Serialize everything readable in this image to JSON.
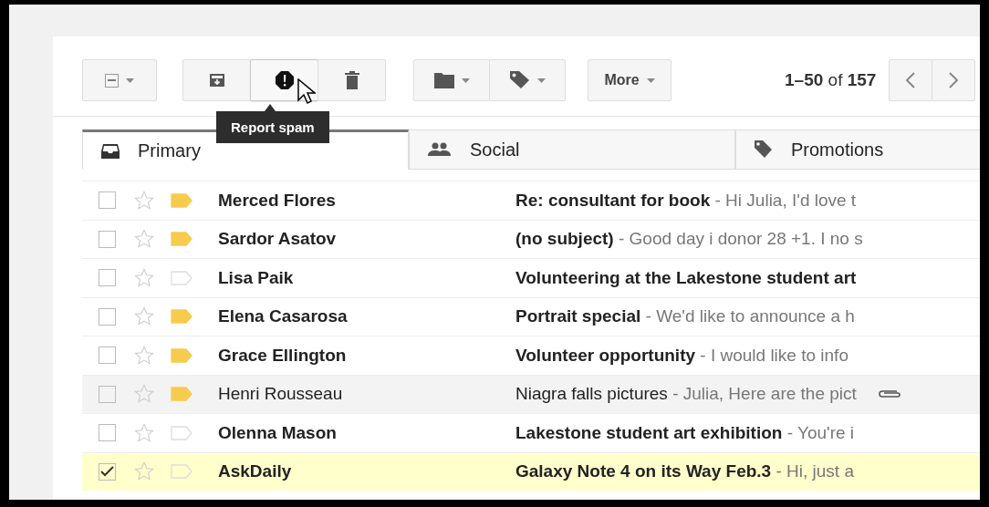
{
  "toolbar": {
    "select_all": {
      "indeterminate": true
    },
    "actions": [
      {
        "kind": "archive",
        "hovered": false
      },
      {
        "kind": "spam",
        "hovered": true
      },
      {
        "kind": "delete",
        "hovered": false
      }
    ],
    "organize": [
      {
        "kind": "folder"
      },
      {
        "kind": "tag"
      }
    ],
    "more": "More",
    "count": "**1–50** of **157**"
  },
  "tooltip": "Report spam",
  "tabs": [
    {
      "label": "Primary",
      "kind": "inbox",
      "selected": true
    },
    {
      "label": "Social",
      "kind": "people",
      "selected": false
    },
    {
      "label": "Promotions",
      "kind": "tag",
      "selected": false
    }
  ],
  "rows": [
    {
      "sender": "Merced Flores",
      "subject": "Re: consultant for book",
      "snippet": "- Hi Julia, I'd love t",
      "unread": true,
      "important": true,
      "checked": false,
      "starred": false,
      "attachment": false
    },
    {
      "sender": "Sardor Asatov",
      "subject": "(no subject)",
      "snippet": "- Good day i donor 28 +1. I no s",
      "unread": true,
      "important": true,
      "checked": false,
      "starred": false,
      "attachment": false
    },
    {
      "sender": "Lisa Paik",
      "subject": "Volunteering at the Lakestone student art",
      "unread": true,
      "important": false,
      "checked": false,
      "starred": false,
      "attachment": false
    },
    {
      "sender": "Elena Casarosa",
      "subject": "Portrait special",
      "snippet": "- We'd like to announce a h",
      "unread": true,
      "important": true,
      "checked": false,
      "starred": false,
      "attachment": false
    },
    {
      "sender": "Grace Ellington",
      "subject": "Volunteer opportunity",
      "snippet": "- I would like to info",
      "unread": true,
      "important": true,
      "checked": false,
      "starred": false,
      "attachment": false
    },
    {
      "sender": "Henri Rousseau",
      "subject": "Niagra falls pictures",
      "snippet": "- Julia, Here are the pict",
      "unread": false,
      "important": true,
      "checked": false,
      "starred": false,
      "attachment": true
    },
    {
      "sender": "Olenna Mason",
      "subject": "Lakestone student art exhibition",
      "snippet": "- You're i",
      "unread": true,
      "important": false,
      "checked": false,
      "starred": false,
      "attachment": false
    },
    {
      "sender": "AskDaily",
      "subject": "Galaxy Note 4 on its Way Feb.3",
      "snippet": "- Hi, just a",
      "unread": true,
      "important": false,
      "checked": true,
      "starred": false,
      "attachment": false
    }
  ]
}
